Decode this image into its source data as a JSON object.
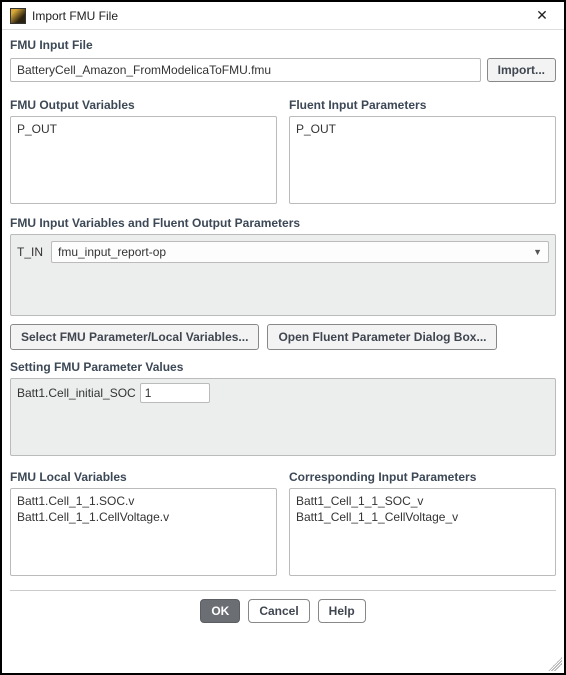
{
  "titlebar": {
    "title": "Import FMU File"
  },
  "file": {
    "header": "FMU Input File",
    "value": "BatteryCell_Amazon_FromModelicaToFMU.fmu",
    "import_label": "Import..."
  },
  "output_vars": {
    "header": "FMU Output Variables",
    "items": [
      "P_OUT"
    ]
  },
  "fluent_input_params": {
    "header": "Fluent Input Parameters",
    "items": [
      "P_OUT"
    ]
  },
  "input_vars_section": {
    "header": "FMU Input Variables and Fluent Output Parameters",
    "var_label": "T_IN",
    "dropdown_value": "fmu_input_report-op"
  },
  "midbuttons": {
    "select_fmu": "Select FMU Parameter/Local Variables...",
    "open_fluent": "Open Fluent Parameter Dialog Box..."
  },
  "setting_section": {
    "header": "Setting FMU Parameter Values",
    "param_label": "Batt1.Cell_initial_SOC",
    "param_value": "1"
  },
  "local_vars": {
    "header": "FMU Local Variables",
    "items": [
      "Batt1.Cell_1_1.SOC.v",
      "Batt1.Cell_1_1.CellVoltage.v"
    ]
  },
  "corresponding_params": {
    "header": "Corresponding Input Parameters",
    "items": [
      "Batt1_Cell_1_1_SOC_v",
      "Batt1_Cell_1_1_CellVoltage_v"
    ]
  },
  "footer": {
    "ok": "OK",
    "cancel": "Cancel",
    "help": "Help"
  }
}
